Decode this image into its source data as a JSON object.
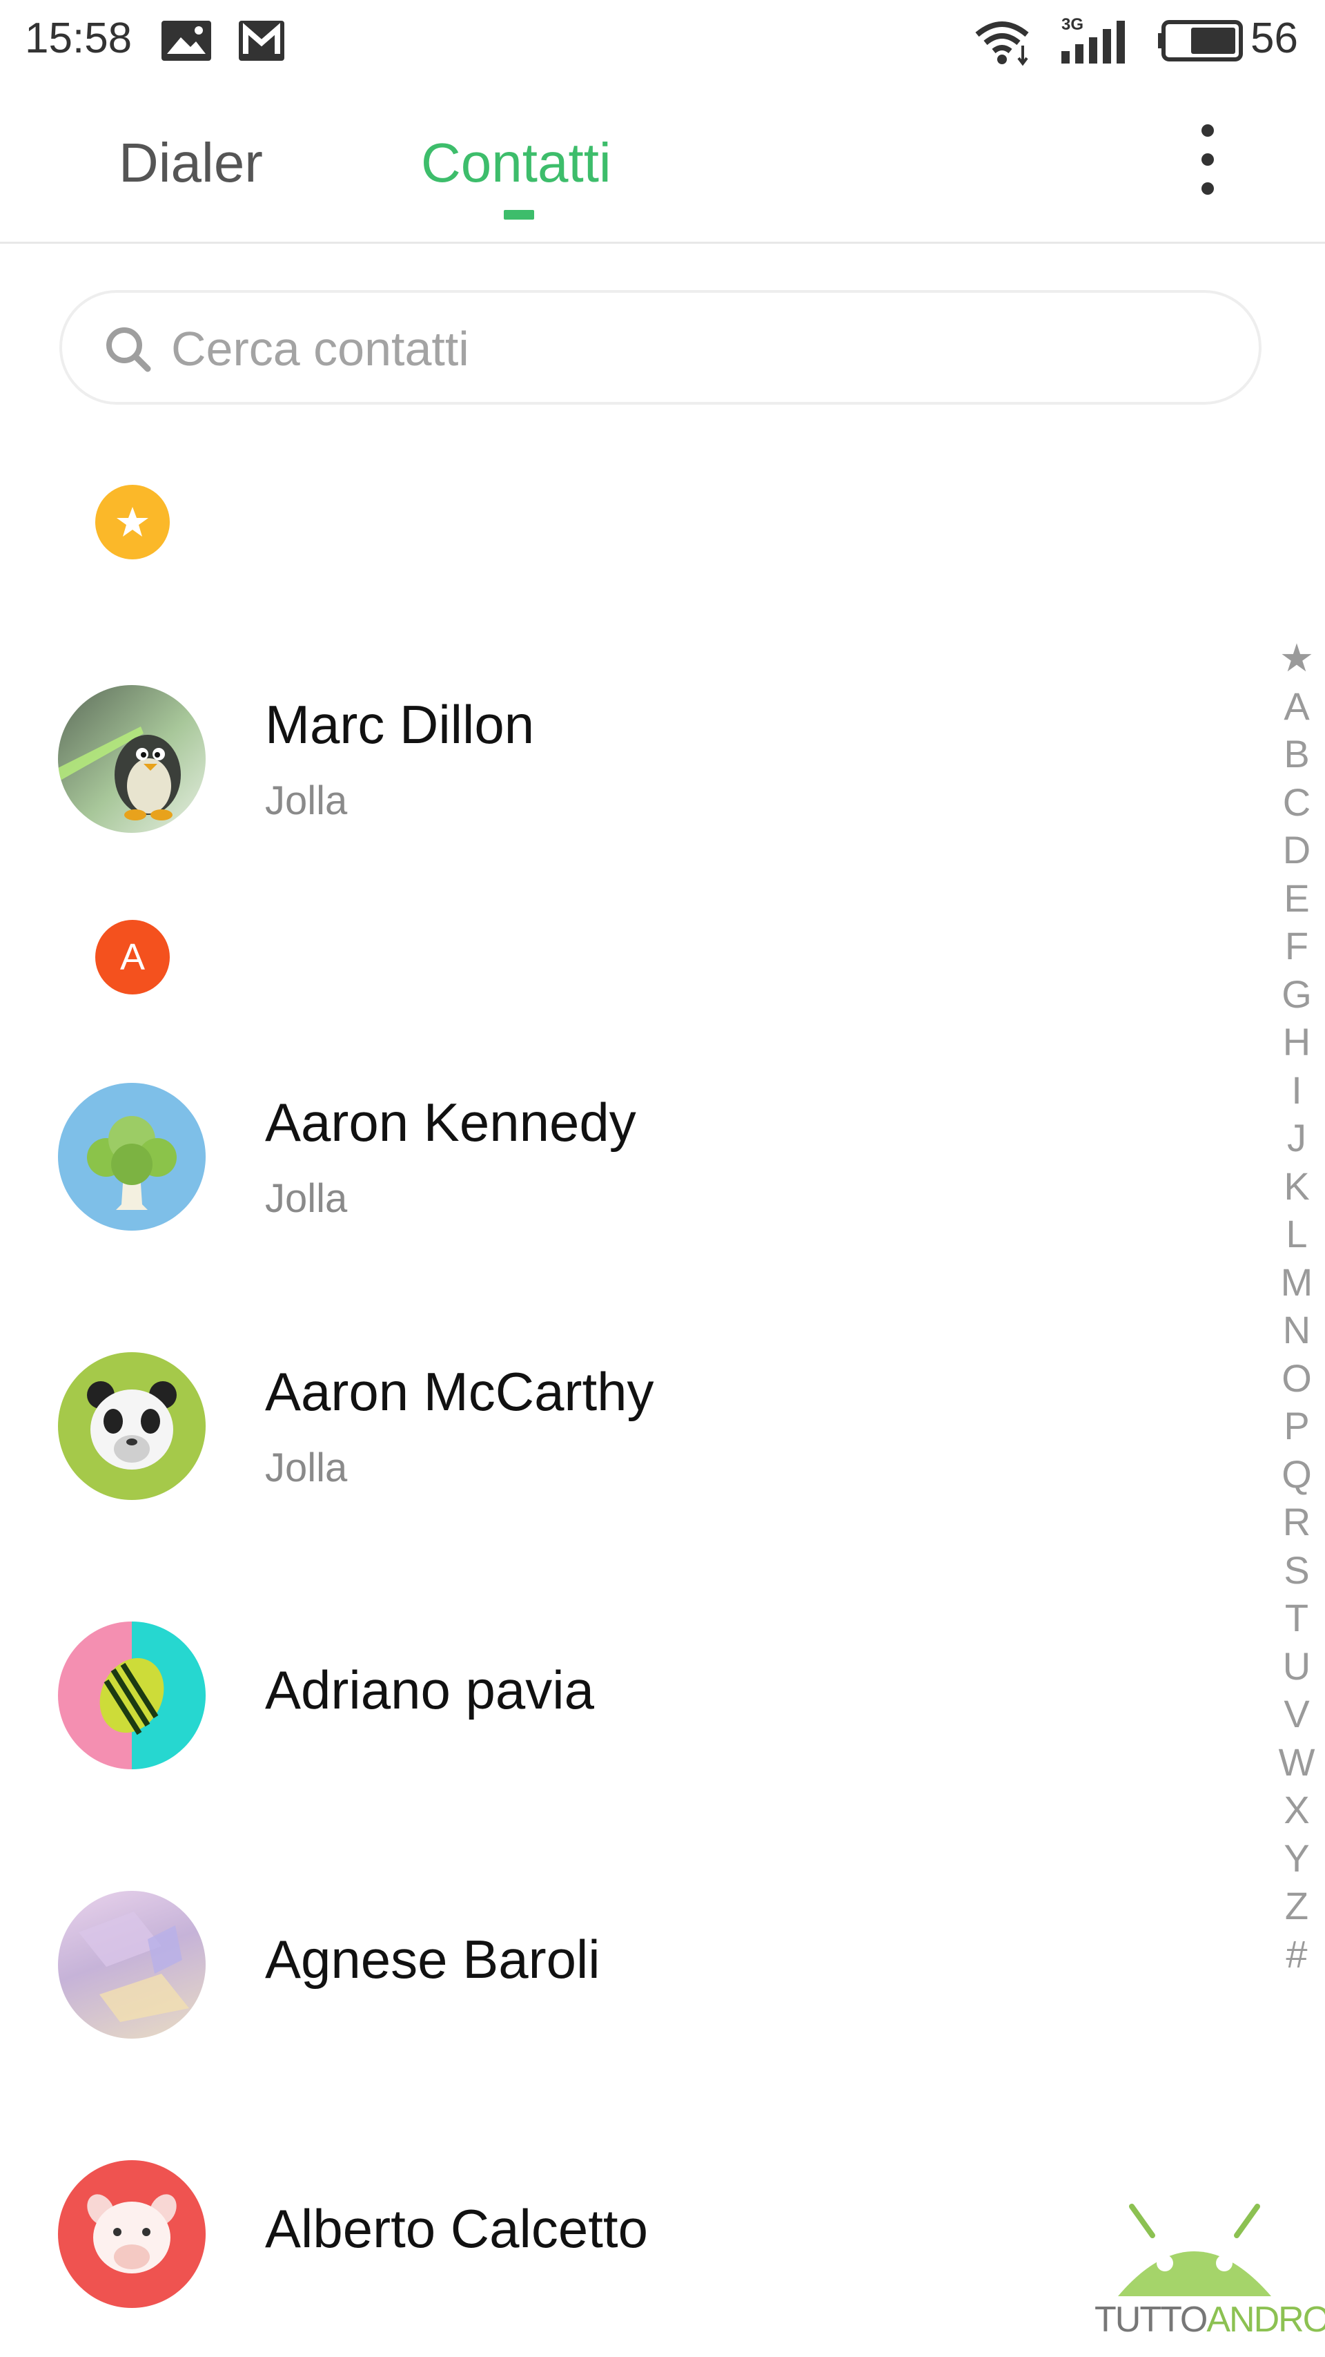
{
  "status_bar": {
    "time": "15:58",
    "network_label": "3G",
    "battery_level": "56",
    "icons": [
      "image-icon",
      "gmail-icon",
      "wifi-icon",
      "signal-icon",
      "battery-icon"
    ]
  },
  "tabs": [
    {
      "label": "Dialer",
      "active": false
    },
    {
      "label": "Contatti",
      "active": true
    }
  ],
  "colors": {
    "accent": "#3dbd6b",
    "favorites_badge": "#fbb829",
    "letter_badge": "#f4511e"
  },
  "search": {
    "placeholder": "Cerca contatti"
  },
  "sections": {
    "favorites_icon": "star-icon",
    "letter_a": "A"
  },
  "contacts": [
    {
      "name": "Marc Dillon",
      "company": "Jolla",
      "avatar": "penguin-avatar"
    },
    {
      "name": "Aaron Kennedy",
      "company": "Jolla",
      "avatar": "broccoli-avatar"
    },
    {
      "name": "Aaron McCarthy",
      "company": "Jolla",
      "avatar": "panda-avatar"
    },
    {
      "name": "Adriano pavia",
      "company": "",
      "avatar": "watermelon-avatar"
    },
    {
      "name": "Agnese Baroli",
      "company": "",
      "avatar": "abstract-avatar"
    },
    {
      "name": "Alberto Calcetto",
      "company": "",
      "avatar": "llama-avatar"
    }
  ],
  "alphabet_index": [
    "★",
    "A",
    "B",
    "C",
    "D",
    "E",
    "F",
    "G",
    "H",
    "I",
    "J",
    "K",
    "L",
    "M",
    "N",
    "O",
    "P",
    "Q",
    "R",
    "S",
    "T",
    "U",
    "V",
    "W",
    "X",
    "Y",
    "Z",
    "#"
  ],
  "watermark": {
    "part1": "TUTTO",
    "part2": "ANDROID"
  }
}
